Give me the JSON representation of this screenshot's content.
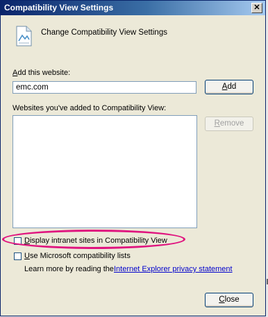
{
  "window": {
    "title": "Compatibility View Settings"
  },
  "header": {
    "text": "Change Compatibility View Settings"
  },
  "add_site": {
    "label_prefix": "",
    "label_accel": "A",
    "label_rest": "dd this website:",
    "value": "emc.com",
    "button_accel": "A",
    "button_rest": "dd"
  },
  "sites_list": {
    "label": "Websites you've added to Compatibility View:",
    "items": [],
    "remove_accel": "R",
    "remove_rest": "emove"
  },
  "options": {
    "intranet_accel": "D",
    "intranet_rest": "isplay intranet sites in Compatibility View",
    "intranet_checked": false,
    "ms_lists_accel": "U",
    "ms_lists_rest": "se Microsoft compatibility lists",
    "ms_lists_checked": false
  },
  "footer": {
    "learn_more": "Learn more by reading the",
    "privacy_link": "Internet Explorer privacy statement",
    "close_accel": "C",
    "close_rest": "lose"
  },
  "colors": {
    "highlight": "#e0147f",
    "link": "#0000cc",
    "titlebar": "#0a246a"
  }
}
